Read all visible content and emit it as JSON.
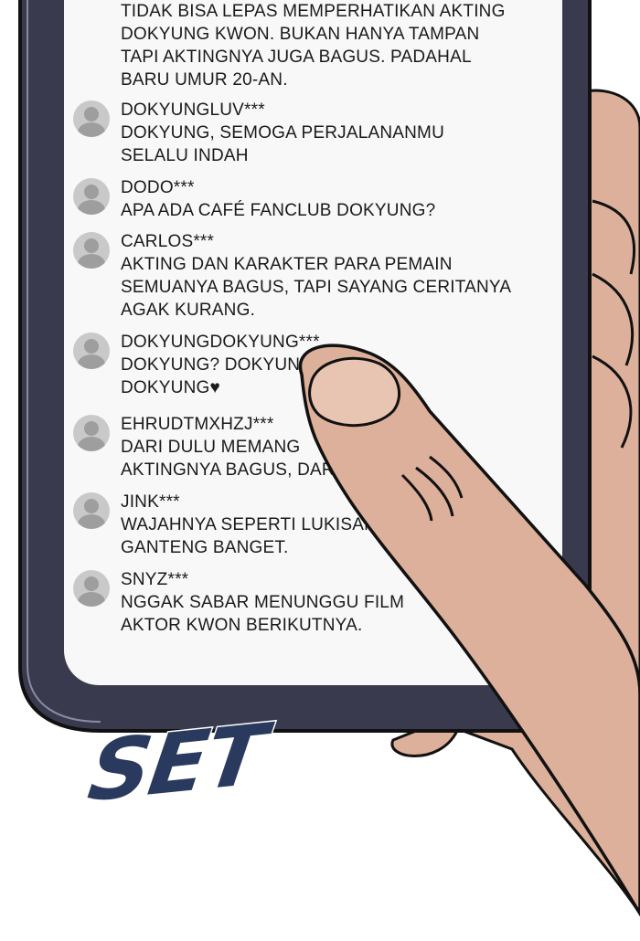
{
  "intro": {
    "lines": [
      "TIDAK BISA LEPAS MEMPERHATIKAN AKTING",
      "DOKYUNG KWON. BUKAN HANYA TAMPAN",
      "TAPI AKTINGNYA JUGA BAGUS. PADAHAL",
      "BARU UMUR 20-AN."
    ]
  },
  "comments": [
    {
      "username": "DOKYUNGLUV***",
      "lines": [
        "DOKYUNG, SEMOGA PERJALANANMU",
        "SELALU INDAH"
      ]
    },
    {
      "username": "DODO***",
      "lines": [
        "APA ADA CAFÉ FANCLUB DOKYUNG?"
      ]
    },
    {
      "username": "CARLOS***",
      "lines": [
        "AKTING DAN KARAKTER PARA PEMAIN",
        "SEMUANYA BAGUS, TAPI SAYANG CERITANYA",
        "AGAK KURANG."
      ]
    },
    {
      "username": "DOKYUNGDOKYUNG***",
      "lines": [
        "DOKYUNG? DOKYUN",
        "DOKYUNG♥"
      ]
    },
    {
      "username": "EHRUDTMXHZJ***",
      "lines": [
        "DARI DULU MEMANG",
        "AKTINGNYA BAGUS, DAR"
      ]
    },
    {
      "username": "JINK***",
      "lines": [
        "WAJAHNYA SEPERTI LUKISAN.",
        "GANTENG BANGET."
      ]
    },
    {
      "username": "SNYZ***",
      "lines": [
        "NGGAK SABAR MENUNGGU FILM",
        "AKTOR KWON BERIKUTNYA."
      ]
    }
  ],
  "sound_effect": "SET",
  "colors": {
    "phone_frame": "#3a3a4e",
    "screen": "#f8f8f8",
    "skin": "#dcb09a",
    "sfx": "#2a3a5e"
  }
}
